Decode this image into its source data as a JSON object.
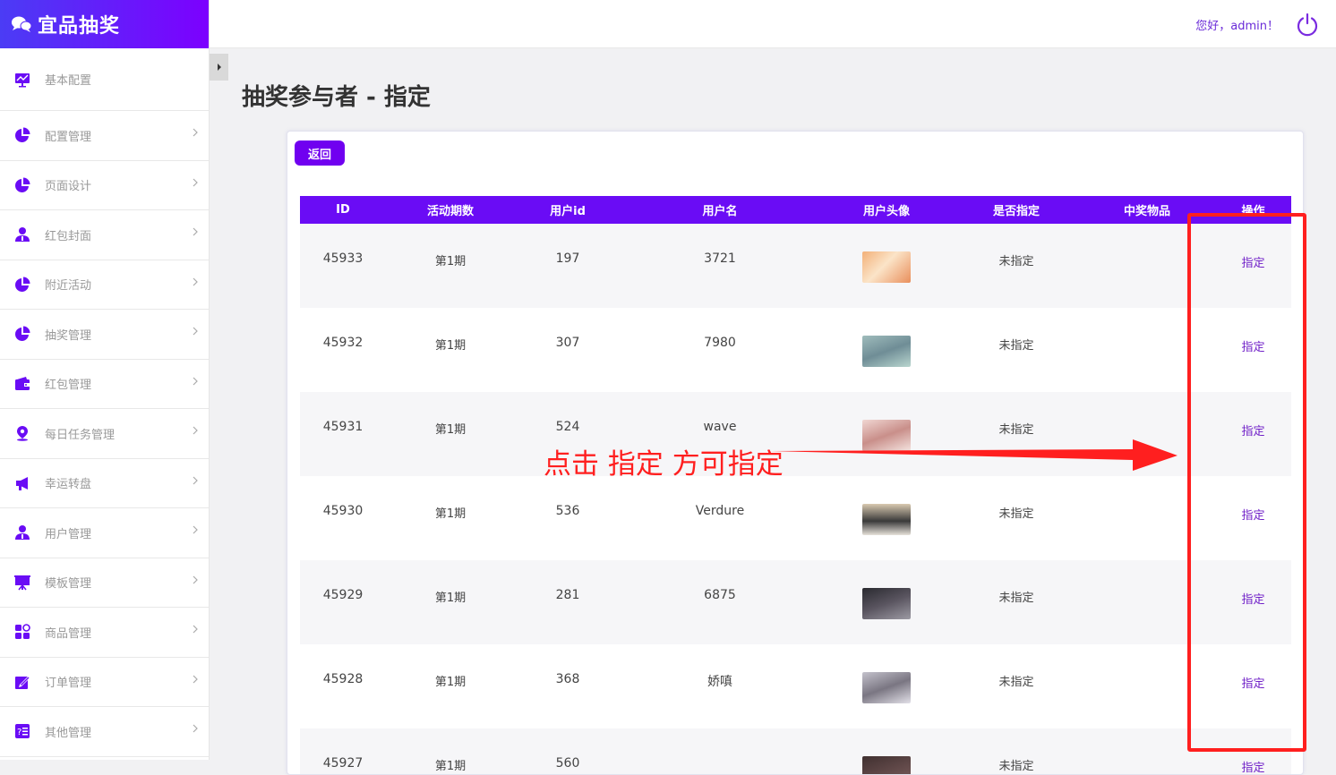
{
  "brand": {
    "title": "宜品抽奖"
  },
  "header": {
    "greeting": "您好，admin！"
  },
  "sidebar": {
    "items": [
      {
        "label": "基本配置",
        "icon": "monitor-chart-icon",
        "has_arrow": false
      },
      {
        "label": "配置管理",
        "icon": "pie-chart-icon",
        "has_arrow": true
      },
      {
        "label": "页面设计",
        "icon": "pie-chart-icon",
        "has_arrow": true
      },
      {
        "label": "红包封面",
        "icon": "user-icon",
        "has_arrow": true
      },
      {
        "label": "附近活动",
        "icon": "pie-chart-icon",
        "has_arrow": true
      },
      {
        "label": "抽奖管理",
        "icon": "pie-chart-icon",
        "has_arrow": true
      },
      {
        "label": "红包管理",
        "icon": "wallet-icon",
        "has_arrow": true
      },
      {
        "label": "每日任务管理",
        "icon": "location-pin-icon",
        "has_arrow": true
      },
      {
        "label": "幸运转盘",
        "icon": "megaphone-icon",
        "has_arrow": true
      },
      {
        "label": "用户管理",
        "icon": "user-icon",
        "has_arrow": true
      },
      {
        "label": "模板管理",
        "icon": "easel-icon",
        "has_arrow": true
      },
      {
        "label": "商品管理",
        "icon": "apps-grid-icon",
        "has_arrow": true
      },
      {
        "label": "订单管理",
        "icon": "edit-icon",
        "has_arrow": true
      },
      {
        "label": "其他管理",
        "icon": "list-help-icon",
        "has_arrow": true
      }
    ]
  },
  "page": {
    "title": "抽奖参与者 - 指定",
    "back_label": "返回"
  },
  "table": {
    "headers": [
      "ID",
      "活动期数",
      "用户id",
      "用户名",
      "用户头像",
      "是否指定",
      "中奖物品",
      "操作"
    ],
    "rows": [
      {
        "id": "45933",
        "period": "第1期",
        "user_id": "197",
        "username": "3721",
        "assigned": "未指定",
        "prize": "",
        "action": "指定"
      },
      {
        "id": "45932",
        "period": "第1期",
        "user_id": "307",
        "username": "7980",
        "assigned": "未指定",
        "prize": "",
        "action": "指定"
      },
      {
        "id": "45931",
        "period": "第1期",
        "user_id": "524",
        "username": "wave",
        "assigned": "未指定",
        "prize": "",
        "action": "指定"
      },
      {
        "id": "45930",
        "period": "第1期",
        "user_id": "536",
        "username": "Verdure",
        "assigned": "未指定",
        "prize": "",
        "action": "指定"
      },
      {
        "id": "45929",
        "period": "第1期",
        "user_id": "281",
        "username": "6875",
        "assigned": "未指定",
        "prize": "",
        "action": "指定"
      },
      {
        "id": "45928",
        "period": "第1期",
        "user_id": "368",
        "username": "娇嗔",
        "assigned": "未指定",
        "prize": "",
        "action": "指定"
      },
      {
        "id": "45927",
        "period": "第1期",
        "user_id": "560",
        "username": "",
        "assigned": "未指定",
        "prize": "",
        "action": "指定"
      }
    ]
  },
  "annotation": {
    "text": "点击 指定 方可指定"
  },
  "colors": {
    "accent": "#6a0cf5",
    "brand_start": "#4b3cf5",
    "brand_end": "#7c00ff",
    "annotation": "#ff1f1f"
  }
}
